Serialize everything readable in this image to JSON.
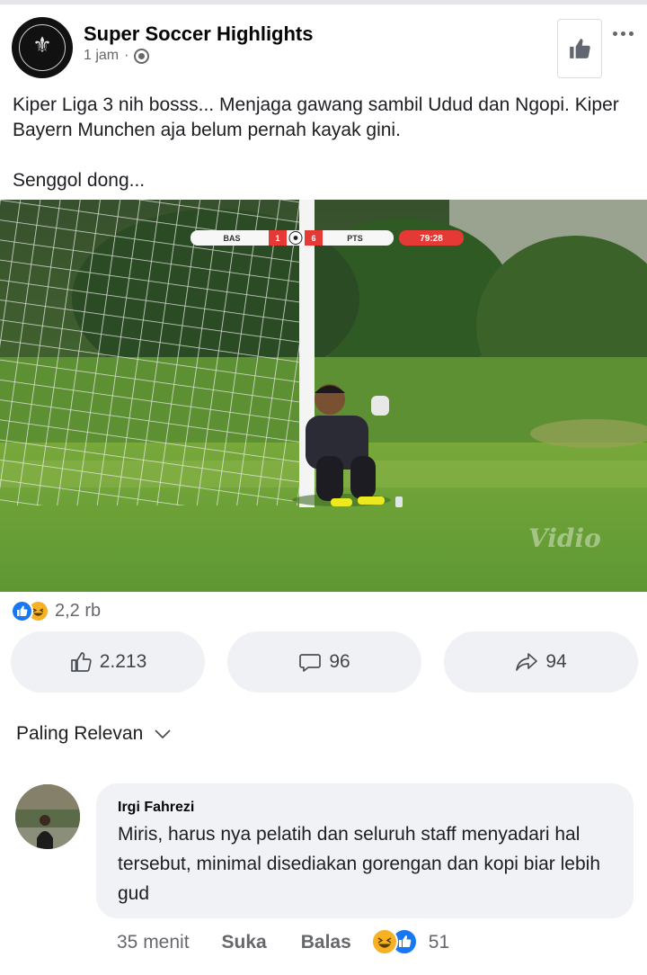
{
  "page": {
    "name": "Super Soccer Highlights",
    "time": "1 jam",
    "separator": "·"
  },
  "post": {
    "text": "Kiper Liga 3 nih bosss... Menjaga gawang sambil Udud dan Ngopi. Kiper Bayern Munchen aja belum pernah kayak gini.",
    "text2": "Senggol dong..."
  },
  "scoreboard": {
    "team_home": "BAS",
    "score_home": "1",
    "score_away": "6",
    "team_away": "PTS",
    "clock": "79:28"
  },
  "watermark": "Vidio",
  "reactions": {
    "count": "2,2 rb"
  },
  "actions": {
    "like_count": "2.213",
    "comment_count": "96",
    "share_count": "94"
  },
  "sort": {
    "label": "Paling Relevan"
  },
  "comment": {
    "author": "Irgi Fahrezi",
    "text": "Miris, harus nya pelatih dan seluruh staff menyadari hal tersebut, minimal disediakan gorengan dan kopi biar lebih gud",
    "time": "35 menit",
    "like_label": "Suka",
    "reply_label": "Balas",
    "reaction_count": "51"
  },
  "colors": {
    "accent": "#1877f2",
    "haha": "#f7b125",
    "secondary_text": "#65676b",
    "button_bg": "#eff1f4",
    "scoreboard_red": "#e53935"
  }
}
